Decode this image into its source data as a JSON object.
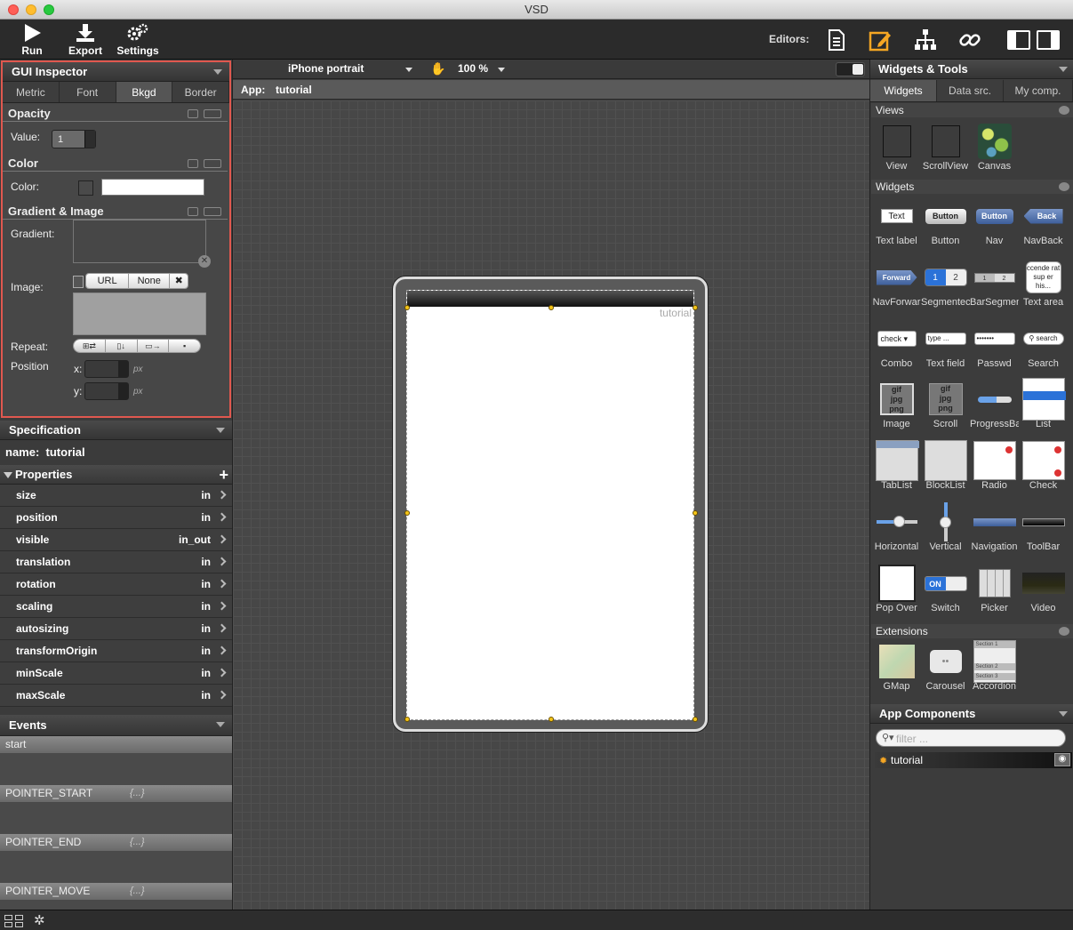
{
  "window": {
    "title": "VSD"
  },
  "toolbar": {
    "run": "Run",
    "export": "Export",
    "settings": "Settings",
    "editors_label": "Editors:"
  },
  "inspector": {
    "title": "GUI Inspector",
    "tabs": [
      "Metric",
      "Font",
      "Bkgd",
      "Border"
    ],
    "active_tab": "Bkgd",
    "opacity": {
      "title": "Opacity",
      "value_label": "Value:",
      "value": "1"
    },
    "color": {
      "title": "Color",
      "color_label": "Color:"
    },
    "gradient": {
      "title": "Gradient & Image",
      "gradient_label": "Gradient:",
      "image_label": "Image:",
      "url_btn": "URL",
      "none_btn": "None",
      "repeat_label": "Repeat:",
      "position_label": "Position",
      "x_label": "x:",
      "y_label": "y:",
      "unit": "px"
    }
  },
  "spec": {
    "title": "Specification",
    "name_label": "name:",
    "name_value": "tutorial",
    "properties_title": "Properties",
    "rows": [
      {
        "name": "size",
        "value": "in"
      },
      {
        "name": "position",
        "value": "in"
      },
      {
        "name": "visible",
        "value": "in_out"
      },
      {
        "name": "translation",
        "value": "in"
      },
      {
        "name": "rotation",
        "value": "in"
      },
      {
        "name": "scaling",
        "value": "in"
      },
      {
        "name": "autosizing",
        "value": "in"
      },
      {
        "name": "transformOrigin",
        "value": "in"
      },
      {
        "name": "minScale",
        "value": "in"
      },
      {
        "name": "maxScale",
        "value": "in"
      }
    ]
  },
  "events": {
    "title": "Events",
    "items": [
      {
        "name": "start",
        "fn": ""
      },
      {
        "name": "POINTER_START",
        "fn": "{...}"
      },
      {
        "name": "POINTER_END",
        "fn": "{...}"
      },
      {
        "name": "POINTER_MOVE",
        "fn": "{...}"
      }
    ]
  },
  "canvas": {
    "device": "iPhone portrait",
    "zoom": "100 %",
    "app_label": "App:",
    "app_name": "tutorial",
    "screen_title": "tutorial"
  },
  "tools": {
    "title": "Widgets & Tools",
    "tabs": [
      "Widgets",
      "Data src.",
      "My comp."
    ],
    "active_tab": "Widgets",
    "views_title": "Views",
    "views": [
      "View",
      "ScrollView",
      "Canvas"
    ],
    "widgets_title": "Widgets",
    "widgets": [
      "Text label",
      "Button",
      "Nav",
      "NavBack",
      "NavForwar",
      "Segmentec",
      "BarSegmen",
      "Text area",
      "Combo",
      "Text field",
      "Passwd",
      "Search",
      "Image",
      "Scroll",
      "ProgressBa",
      "List",
      "TabList",
      "BlockList",
      "Radio",
      "Check",
      "Horizontal",
      "Vertical",
      "Navigation",
      "ToolBar",
      "Pop Over",
      "Switch",
      "Picker",
      "Video"
    ],
    "widget_samples": {
      "text": "Text",
      "button": "Button",
      "nav": "Button",
      "back": "Back",
      "forward": "Forward",
      "seg1": "1",
      "seg2": "2",
      "textarea": "ccende rat sup er his...",
      "combo": "check",
      "textfield": "type ...",
      "passwd": "•••••••",
      "search": "search",
      "switch_on": "ON"
    },
    "extensions_title": "Extensions",
    "extensions": [
      "GMap",
      "Carousel",
      "Accordion"
    ],
    "accordion_sections": [
      "Section 1",
      "Section 2",
      "Section 3"
    ]
  },
  "components": {
    "title": "App Components",
    "filter_placeholder": "filter ...",
    "items": [
      "tutorial"
    ]
  }
}
